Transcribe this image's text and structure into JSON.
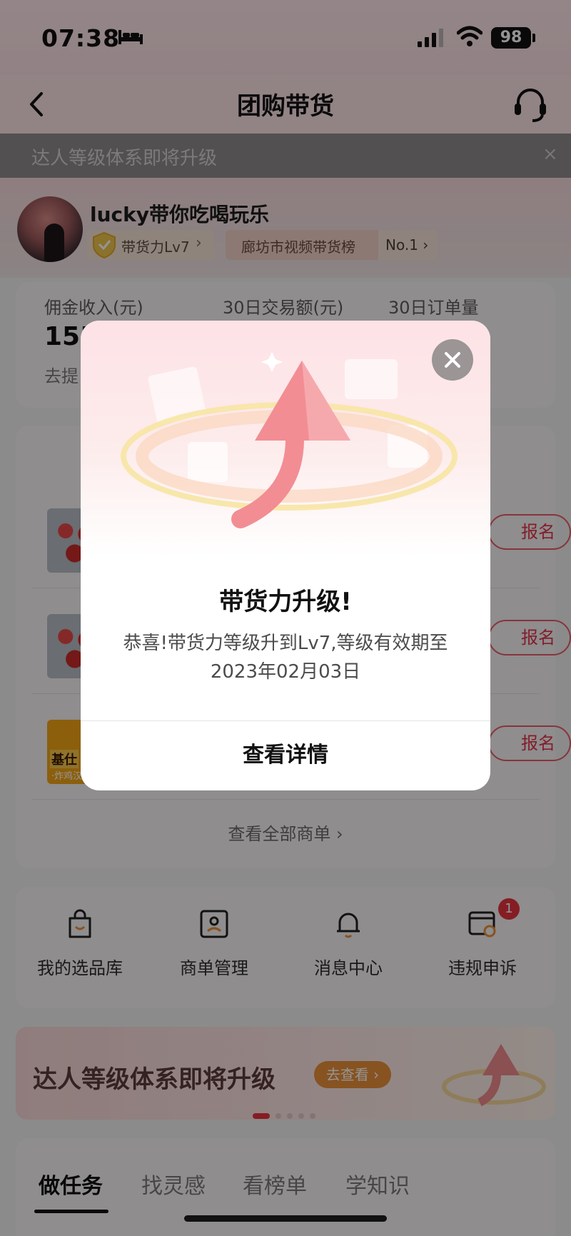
{
  "status_bar": {
    "time": "07:38",
    "battery": "98"
  },
  "nav": {
    "title": "团购带货"
  },
  "notice": {
    "text": "达人等级体系即将升级",
    "close": "×"
  },
  "profile": {
    "username": "lucky带你吃喝玩乐",
    "level_badge": "带货力Lv7",
    "rank_badge": "廊坊市视频带货榜",
    "rank_no": "No.1"
  },
  "stats": {
    "labels": [
      "佣金收入(元)",
      "30日交易额(元)",
      "30日订单量"
    ],
    "value_partial": "155",
    "withdraw_partial": "去提"
  },
  "products": {
    "items": [
      {
        "button": "报名",
        "image": "flower-bouquet"
      },
      {
        "button": "报名",
        "image": "flower-bouquet"
      },
      {
        "button": "报名",
        "image": "chicken-burger",
        "image_text": "基仕",
        "image_subtext": "·炸鸡汉"
      }
    ],
    "view_all": "查看全部商单"
  },
  "shortcuts": [
    {
      "label": "我的选品库",
      "icon": "shopping-bag-icon"
    },
    {
      "label": "商单管理",
      "icon": "id-card-icon"
    },
    {
      "label": "消息中心",
      "icon": "bell-icon"
    },
    {
      "label": "违规申诉",
      "icon": "appeal-icon",
      "badge": "1"
    }
  ],
  "promo": {
    "title": "达人等级体系即将升级",
    "button": "去查看"
  },
  "tabs": [
    "做任务",
    "找灵感",
    "看榜单",
    "学知识"
  ],
  "modal": {
    "title": "带货力升级!",
    "body": "恭喜!带货力等级升到Lv7,等级有效期至2023年02月03日",
    "action": "查看详情"
  },
  "colors": {
    "accent": "#e2334b",
    "brand_pink": "#fbe2e6",
    "promo_button": "#e8903a"
  }
}
